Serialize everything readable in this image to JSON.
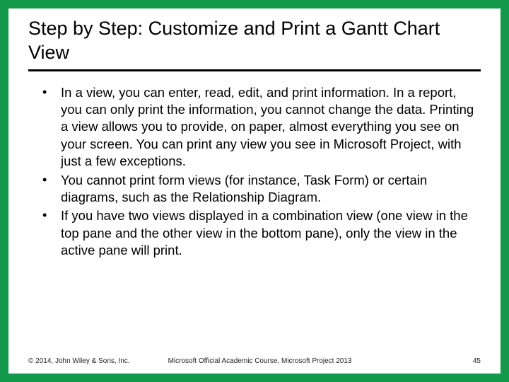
{
  "title": "Step by Step: Customize and Print a Gantt Chart View",
  "bullets": [
    "In a view, you can enter, read, edit, and print information. In a report, you can only print the information, you cannot change the data. Printing a view allows you to provide, on paper, almost everything you see on your screen. You can print any view you see in Microsoft Project, with just a few exceptions.",
    "You cannot print form views (for instance, Task Form) or certain diagrams, such as the Relationship Diagram.",
    "If you have two views displayed in a combination view (one view in the top pane and the other view in the bottom pane), only the view in the active pane will print."
  ],
  "footer": {
    "copyright": "© 2014, John Wiley & Sons, Inc.",
    "course": "Microsoft Official Academic Course, Microsoft Project 2013",
    "page": "45"
  }
}
